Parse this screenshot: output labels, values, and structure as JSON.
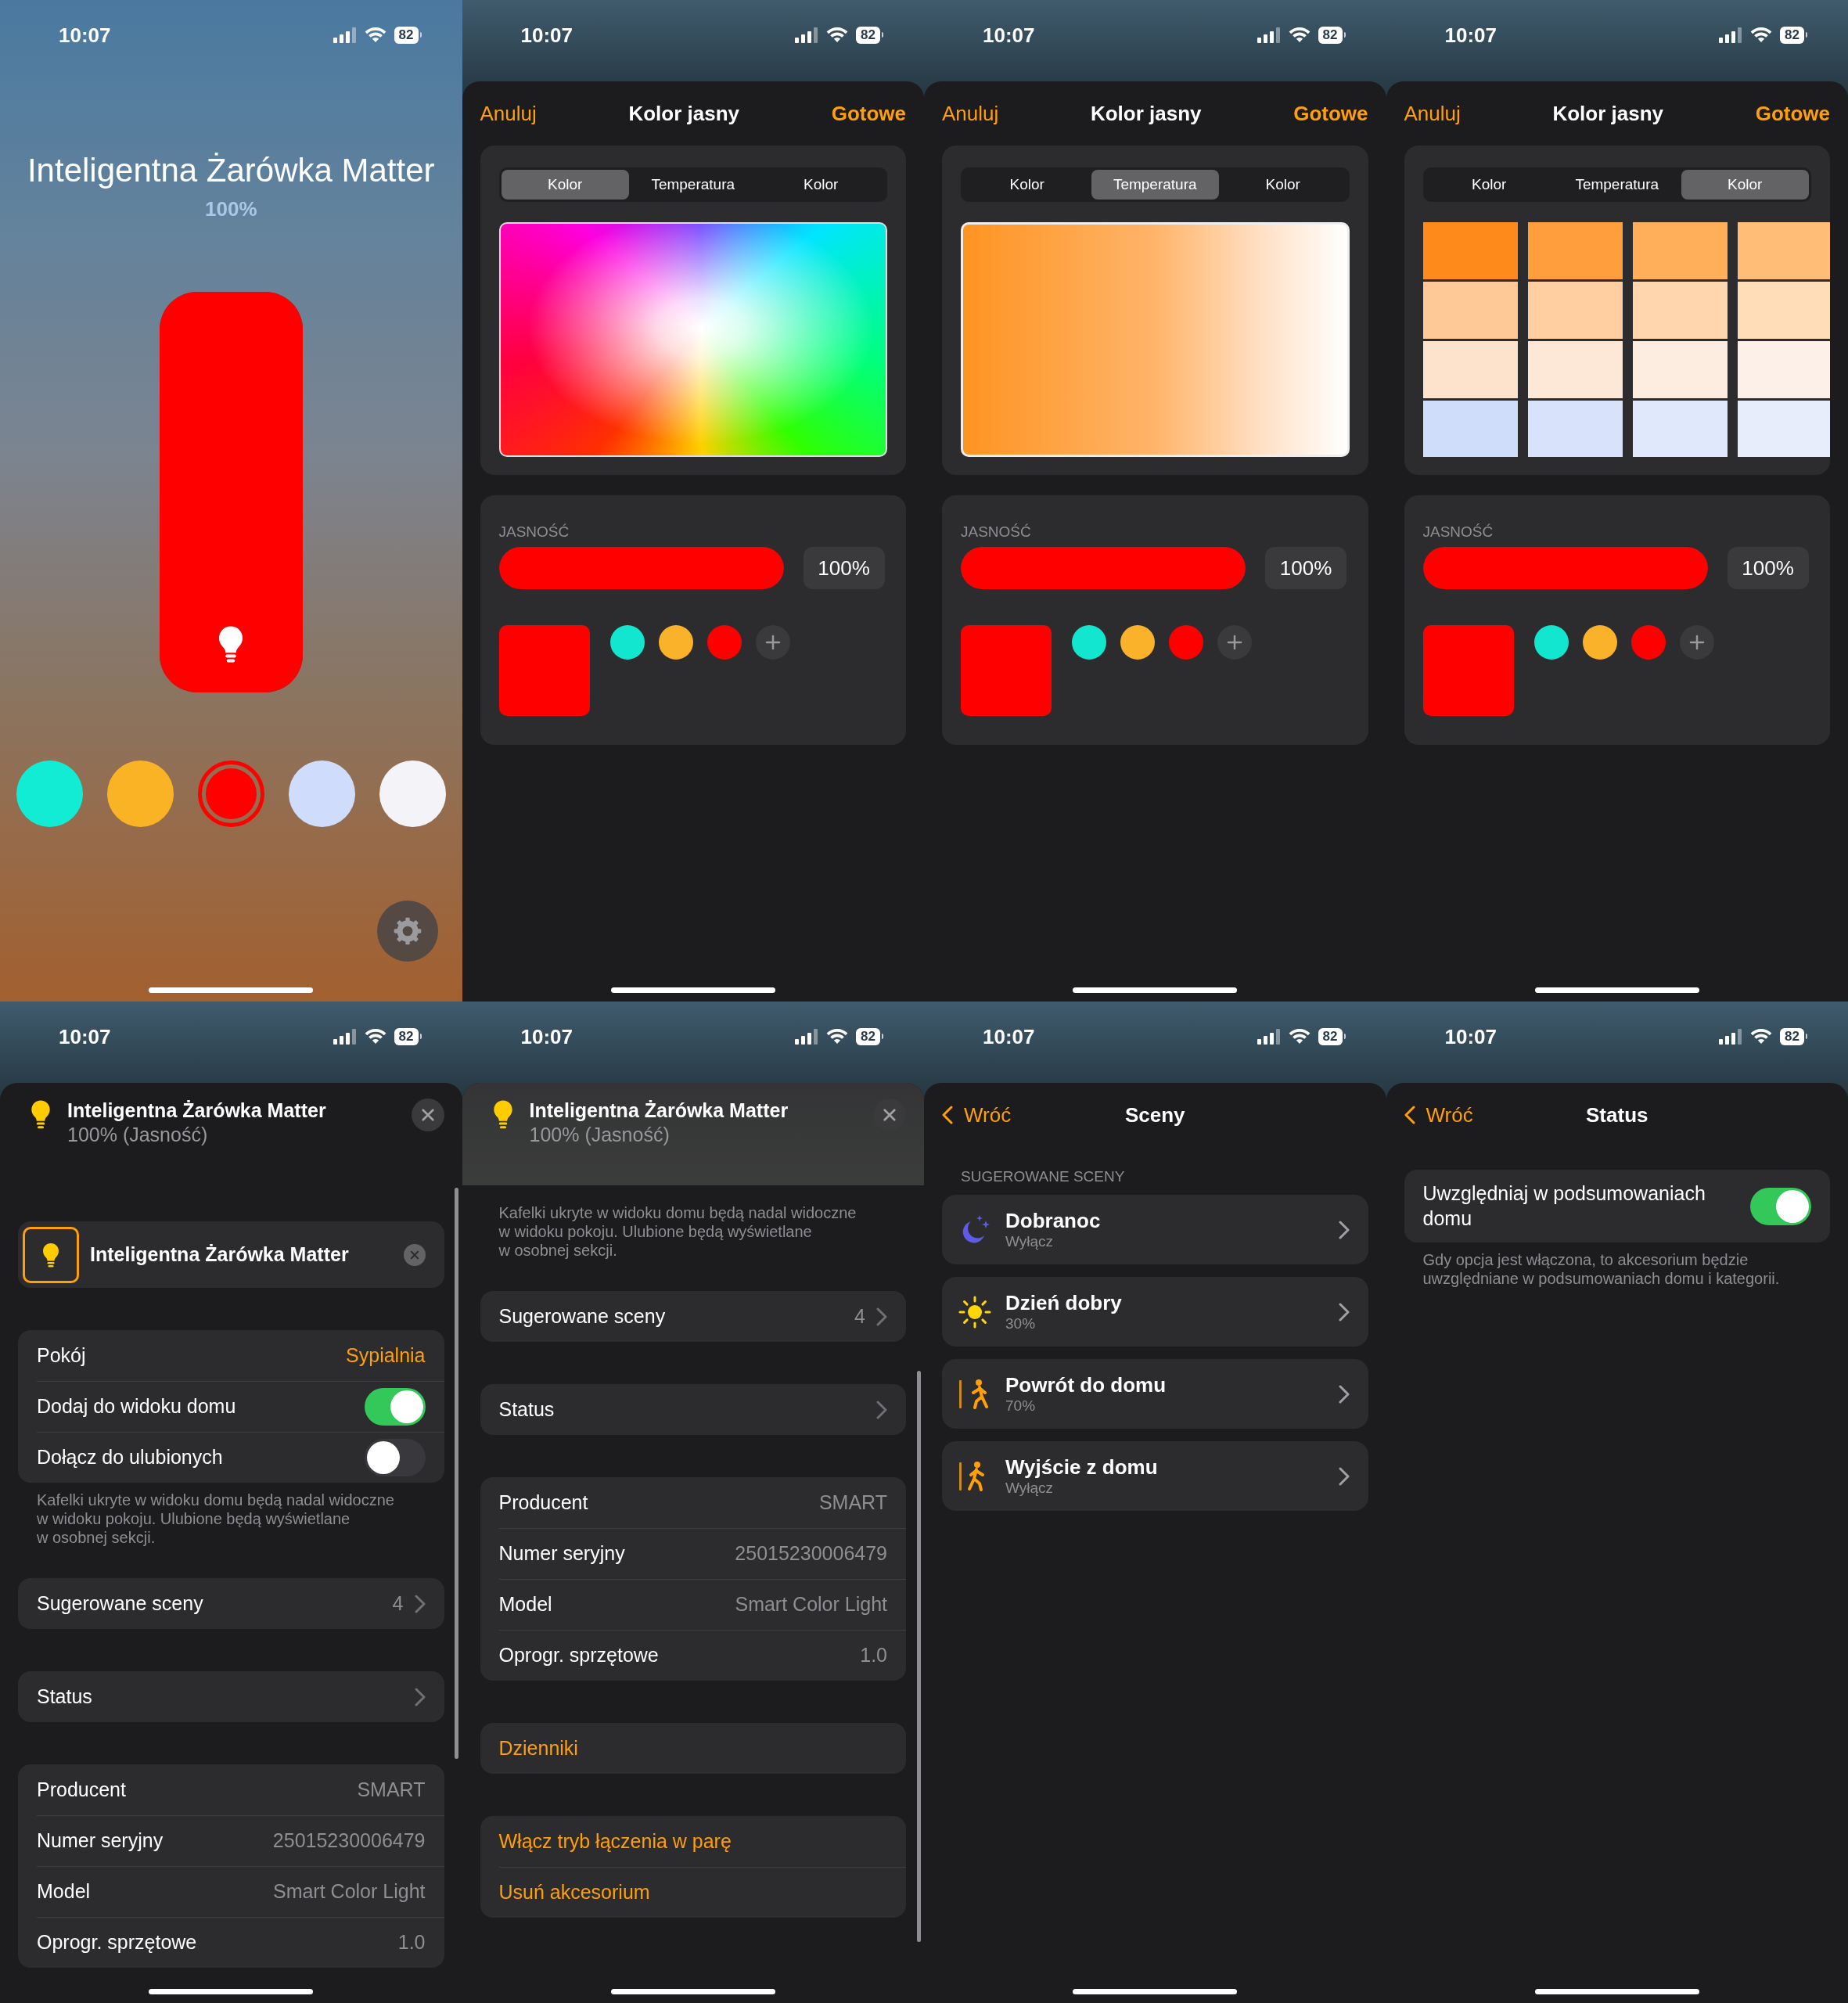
{
  "screens": [
    {
      "kind": "control",
      "status_bar": {
        "time": "10:07",
        "battery": "82"
      },
      "title": "Inteligentna Żarówka Matter",
      "reading": "100%",
      "level": 1,
      "swatches": [
        {
          "color": "#13ecd4",
          "selected": false
        },
        {
          "color": "#fbb326",
          "selected": false
        },
        {
          "color": "#ff0000",
          "selected": true
        },
        {
          "color": "#cfdcfb",
          "selected": false
        },
        {
          "color": "#f4f3f8",
          "selected": false
        }
      ]
    },
    {
      "kind": "editor",
      "status_bar": {
        "time": "10:07",
        "battery": "82"
      },
      "nav": {
        "cancel": "Anuluj",
        "title": "Kolor jasny",
        "done": "Gotowe"
      },
      "segments": [
        {
          "label": "Kolor",
          "selected": true
        },
        {
          "label": "Temperatura",
          "selected": false
        },
        {
          "label": "Kolor",
          "selected": false
        }
      ],
      "brightness": {
        "label": "JASNOŚĆ",
        "level": 1,
        "reading": "100%"
      },
      "favorites": [
        {
          "color": "#13e6cf"
        },
        {
          "color": "#fbb22b"
        },
        {
          "color": "#ff0000"
        }
      ]
    },
    {
      "kind": "editor",
      "status_bar": {
        "time": "10:07",
        "battery": "82"
      },
      "nav": {
        "cancel": "Anuluj",
        "title": "Kolor jasny",
        "done": "Gotowe"
      },
      "segments": [
        {
          "label": "Kolor",
          "selected": false
        },
        {
          "label": "Temperatura",
          "selected": true
        },
        {
          "label": "Kolor",
          "selected": false
        }
      ],
      "brightness": {
        "label": "JASNOŚĆ",
        "level": 1,
        "reading": "100%"
      },
      "favorites": [
        {
          "color": "#13e6cf"
        },
        {
          "color": "#fbb22b"
        },
        {
          "color": "#ff0000"
        }
      ]
    },
    {
      "kind": "editor",
      "status_bar": {
        "time": "10:07",
        "battery": "82"
      },
      "nav": {
        "cancel": "Anuluj",
        "title": "Kolor jasny",
        "done": "Gotowe"
      },
      "segments": [
        {
          "label": "Kolor",
          "selected": false
        },
        {
          "label": "Temperatura",
          "selected": false
        },
        {
          "label": "Kolor",
          "selected": true
        }
      ],
      "brightness": {
        "label": "JASNOŚĆ",
        "level": 1,
        "reading": "100%"
      },
      "favorites": [
        {
          "color": "#13e6cf"
        },
        {
          "color": "#fbb22b"
        },
        {
          "color": "#ff0000"
        }
      ]
    },
    {
      "kind": "details",
      "status_bar": {
        "time": "10:07",
        "battery": "82"
      },
      "header": {
        "title": "Inteligentna Żarówka Matter",
        "subtitle": "100% (Jasność)",
        "scrolled": false
      },
      "sections": [
        {
          "rows": [
            {
              "kind": "tile",
              "label": "Inteligentna Żarówka Matter"
            }
          ]
        },
        {
          "rows": [
            {
              "kind": "menu",
              "label": "Pokój",
              "value": "Sypialnia"
            },
            {
              "kind": "toggle",
              "label": "Dodaj do widoku domu",
              "on": true
            },
            {
              "kind": "toggle",
              "label": "Dołącz do ulubionych",
              "on": false
            }
          ],
          "footer": "Kafelki ukryte w widoku domu będą nadal widoczne\nw widoku pokoju. Ulubione będą wyświetlane\nw osobnej sekcji."
        },
        {
          "rows": [
            {
              "kind": "link",
              "label": "Sugerowane sceny",
              "value": "4"
            }
          ]
        },
        {
          "rows": [
            {
              "kind": "link",
              "label": "Status"
            }
          ]
        },
        {
          "rows": [
            {
              "kind": "value",
              "label": "Producent",
              "value": "SMART"
            },
            {
              "kind": "value",
              "label": "Numer seryjny",
              "value": "25015230006479"
            },
            {
              "kind": "value",
              "label": "Model",
              "value": "Smart Color Light"
            },
            {
              "kind": "value",
              "label": "Oprogr. sprzętowe",
              "value": "1.0"
            }
          ]
        }
      ]
    },
    {
      "kind": "details",
      "status_bar": {
        "time": "10:07",
        "battery": "82"
      },
      "header": {
        "title": "Inteligentna Żarówka Matter",
        "subtitle": "100% (Jasność)",
        "scrolled": true
      },
      "sections": [
        {
          "footer": "Kafelki ukryte w widoku domu będą nadal widoczne\nw widoku pokoju. Ulubione będą wyświetlane\nw osobnej sekcji."
        },
        {
          "rows": [
            {
              "kind": "link",
              "label": "Sugerowane sceny",
              "value": "4"
            }
          ]
        },
        {
          "rows": [
            {
              "kind": "link",
              "label": "Status"
            }
          ]
        },
        {
          "rows": [
            {
              "kind": "value",
              "label": "Producent",
              "value": "SMART"
            },
            {
              "kind": "value",
              "label": "Numer seryjny",
              "value": "25015230006479"
            },
            {
              "kind": "value",
              "label": "Model",
              "value": "Smart Color Light"
            },
            {
              "kind": "value",
              "label": "Oprogr. sprzętowe",
              "value": "1.0"
            }
          ]
        },
        {
          "rows": [
            {
              "kind": "action",
              "label": "Dzienniki"
            }
          ]
        },
        {
          "rows": [
            {
              "kind": "action",
              "label": "Włącz tryb łączenia w parę"
            },
            {
              "kind": "action",
              "label": "Usuń akcesorium"
            }
          ]
        }
      ]
    },
    {
      "kind": "page",
      "status_bar": {
        "time": "10:07",
        "battery": "82"
      },
      "nav": {
        "back": "Wróć",
        "title": "Sceny"
      },
      "section_title": "SUGEROWANE SCENY",
      "scenes": [
        {
          "kind": "night",
          "name": "Dobranoc",
          "detail": "Wyłącz"
        },
        {
          "kind": "morning",
          "name": "Dzień dobry",
          "detail": "30%"
        },
        {
          "kind": "arrive",
          "name": "Powrót do domu",
          "detail": "70%"
        },
        {
          "kind": "leave",
          "name": "Wyjście z domu",
          "detail": "Wyłącz"
        }
      ]
    },
    {
      "kind": "page",
      "status_bar": {
        "time": "10:07",
        "battery": "82"
      },
      "nav": {
        "back": "Wróć",
        "title": "Status"
      },
      "sections": [
        {
          "rows": [
            {
              "kind": "toggle",
              "label": "Uwzględniaj w podsumowaniach domu",
              "on": true
            }
          ],
          "footer": "Gdy opcja jest włączona, to akcesorium będzie\nuwzględniane w podsumowaniach domu i kategorii."
        }
      ]
    }
  ]
}
